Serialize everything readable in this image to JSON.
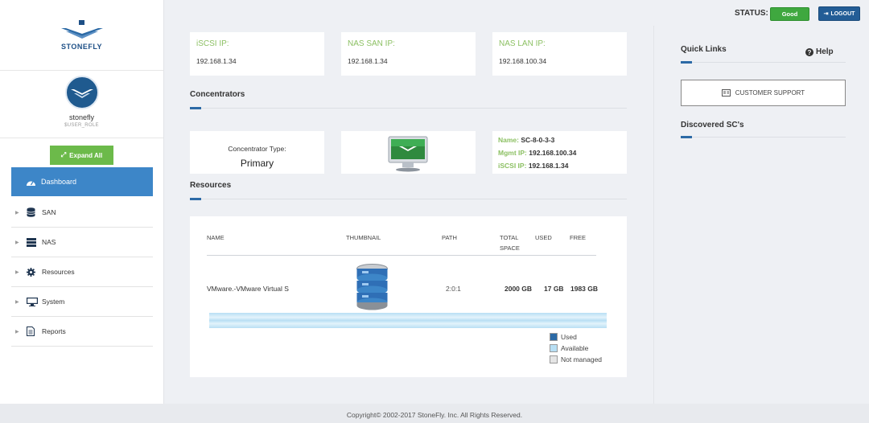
{
  "brand": {
    "logo_text": "STONEFLY"
  },
  "user": {
    "name": "stonefly",
    "role": "$USER_ROLE"
  },
  "sidebar": {
    "expand_label": "Expand All",
    "active_item": "Dashboard",
    "items": [
      {
        "label": "SAN",
        "icon": "database-icon"
      },
      {
        "label": "NAS",
        "icon": "server-icon"
      },
      {
        "label": "Resources",
        "icon": "gear-icon"
      },
      {
        "label": "System",
        "icon": "monitor-icon"
      },
      {
        "label": "Reports",
        "icon": "document-icon"
      }
    ]
  },
  "header": {
    "status_label": "STATUS:",
    "status_value": "Good",
    "logout_label": "LOGOUT",
    "colors": {
      "status": "#3fa83f",
      "logout": "#235d96",
      "accent": "#2c6aa6",
      "label_green": "#8cc063"
    }
  },
  "ips": [
    {
      "label": "iSCSI IP:",
      "value": "192.168.1.34"
    },
    {
      "label": "NAS SAN IP:",
      "value": "192.168.1.34"
    },
    {
      "label": "NAS LAN IP:",
      "value": "192.168.100.34"
    }
  ],
  "concentrators": {
    "title": "Concentrators",
    "type_label": "Concentrator Type:",
    "type_value": "Primary",
    "name_key": "Name:",
    "name_value": "SC-8-0-3-3",
    "mgmt_key": "Mgmt IP:",
    "mgmt_value": "192.168.100.34",
    "iscsi_key": "iSCSI IP:",
    "iscsi_value": "192.168.1.34"
  },
  "resources": {
    "title": "Resources",
    "columns": {
      "name": "NAME",
      "thumbnail": "THUMBNAIL",
      "path": "PATH",
      "total1": "TOTAL",
      "total2": "SPACE",
      "used": "USED",
      "free": "FREE"
    },
    "row": {
      "name": "VMware.-VMware Virtual S",
      "path": "2:0:1",
      "total": "2000 GB",
      "used": "17 GB",
      "free": "1983 GB"
    },
    "legend": [
      "Used",
      "Available",
      "Not managed"
    ]
  },
  "right": {
    "quick_links": "Quick Links",
    "help": "Help",
    "customer_support": "CUSTOMER SUPPORT",
    "discovered": "Discovered SC's"
  },
  "footer": {
    "copyright": "Copyright© 2002-2017 StoneFly. Inc. All Rights Reserved."
  }
}
